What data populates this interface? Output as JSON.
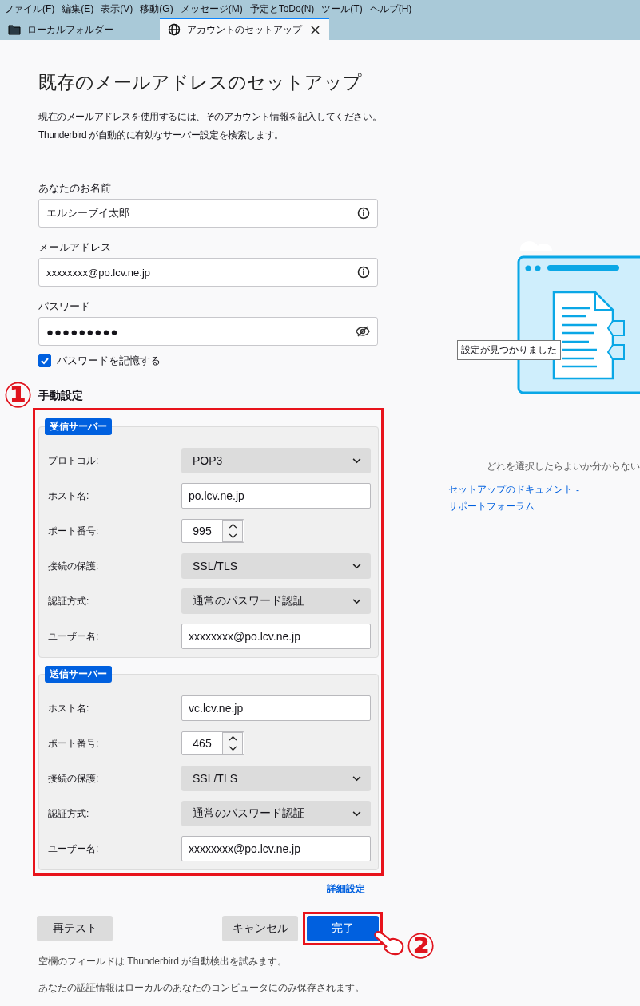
{
  "menu_bar": {
    "items": [
      "ファイル(F)",
      "編集(E)",
      "表示(V)",
      "移動(G)",
      "メッセージ(M)",
      "予定とToDo(N)",
      "ツール(T)",
      "ヘルプ(H)"
    ]
  },
  "tabs": [
    {
      "label": "ローカルフォルダー",
      "kind": "folder",
      "selected": false,
      "closable": false
    },
    {
      "label": "アカウントのセットアップ",
      "kind": "globe",
      "selected": true,
      "closable": true
    }
  ],
  "page": {
    "title": "既存のメールアドレスのセットアップ",
    "intro": [
      "現在のメールアドレスを使用するには、そのアカウント情報を記入してください。",
      "Thunderbird が自動的に有効なサーバー設定を検索します。"
    ]
  },
  "fields": [
    {
      "label": "あなたのお名前",
      "value": "エルシーブイ太郎",
      "kind": "text"
    },
    {
      "label": "メールアドレス",
      "value": "xxxxxxxx@po.lcv.ne.jp",
      "kind": "text"
    },
    {
      "label": "パスワード",
      "value": "●●●●●●●●●",
      "kind": "password"
    }
  ],
  "remember_password": {
    "label": "パスワードを記憶する",
    "checked": true
  },
  "manual": {
    "title": "手動設定",
    "callout": "①",
    "servers": [
      {
        "legend": "受信サーバー",
        "rows": [
          {
            "label": "プロトコル:",
            "kind": "select",
            "value": "POP3"
          },
          {
            "label": "ホスト名:",
            "kind": "text",
            "value": "po.lcv.ne.jp"
          },
          {
            "label": "ポート番号:",
            "kind": "number",
            "value": "995"
          },
          {
            "label": "接続の保護:",
            "kind": "select",
            "value": "SSL/TLS"
          },
          {
            "label": "認証方式:",
            "kind": "select",
            "value": "通常のパスワード認証"
          },
          {
            "label": "ユーザー名:",
            "kind": "text",
            "value": "xxxxxxxx@po.lcv.ne.jp"
          }
        ]
      },
      {
        "legend": "送信サーバー",
        "rows": [
          {
            "label": "ホスト名:",
            "kind": "text",
            "value": "vc.lcv.ne.jp"
          },
          {
            "label": "ポート番号:",
            "kind": "number",
            "value": "465"
          },
          {
            "label": "接続の保護:",
            "kind": "select",
            "value": "SSL/TLS"
          },
          {
            "label": "認証方式:",
            "kind": "select",
            "value": "通常のパスワード認証"
          },
          {
            "label": "ユーザー名:",
            "kind": "text",
            "value": "xxxxxxxx@po.lcv.ne.jp"
          }
        ]
      }
    ]
  },
  "advanced_link": "詳細設定",
  "buttons": [
    {
      "label": "再テスト",
      "kind": "secondary",
      "highlighted": false
    },
    {
      "label": "キャンセル",
      "kind": "secondary",
      "highlighted": false
    },
    {
      "label": "完了",
      "kind": "primary",
      "highlighted": true
    }
  ],
  "finish_callout": "②",
  "notes": [
    "空欄のフィールドは Thunderbird が自動検出を試みます。",
    "あなたの認証情報はローカルのあなたのコンピュータにのみ保存されます。"
  ],
  "illustration": {
    "tooltip": "設定が見つかりました"
  },
  "help": {
    "text": "どれを選択したらよいか分からない",
    "links": [
      "セットアップのドキュメント",
      "サポートフォーラム"
    ],
    "separator": "-"
  }
}
